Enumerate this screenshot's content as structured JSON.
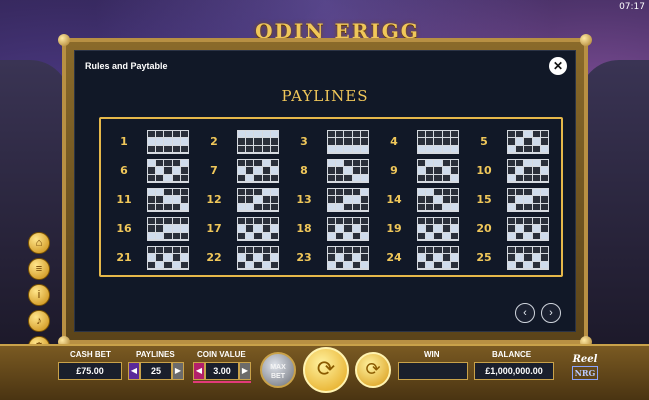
{
  "status": {
    "clock": "07:17"
  },
  "logo": {
    "text": "ODIN ERIGG"
  },
  "dialog": {
    "title": "Rules and Paytable",
    "close_symbol": "✕",
    "section_title": "PAYLINES"
  },
  "paylines": [
    {
      "number": "1",
      "pattern": [
        [
          0,
          0,
          0,
          0,
          0
        ],
        [
          1,
          1,
          1,
          1,
          1
        ],
        [
          0,
          0,
          0,
          0,
          0
        ]
      ]
    },
    {
      "number": "2",
      "pattern": [
        [
          1,
          1,
          1,
          1,
          1
        ],
        [
          0,
          0,
          0,
          0,
          0
        ],
        [
          0,
          0,
          0,
          0,
          0
        ]
      ]
    },
    {
      "number": "3",
      "pattern": [
        [
          0,
          0,
          0,
          0,
          0
        ],
        [
          0,
          0,
          0,
          0,
          0
        ],
        [
          1,
          1,
          1,
          1,
          1
        ]
      ]
    },
    {
      "number": "4",
      "pattern": [
        [
          0,
          0,
          0,
          0,
          0
        ],
        [
          0,
          0,
          0,
          0,
          0
        ],
        [
          1,
          1,
          1,
          1,
          1
        ]
      ]
    },
    {
      "number": "5",
      "pattern": [
        [
          0,
          0,
          1,
          0,
          0
        ],
        [
          0,
          1,
          0,
          1,
          0
        ],
        [
          1,
          0,
          0,
          0,
          1
        ]
      ]
    },
    {
      "number": "6",
      "pattern": [
        [
          1,
          0,
          0,
          0,
          1
        ],
        [
          0,
          1,
          0,
          1,
          0
        ],
        [
          0,
          0,
          1,
          0,
          0
        ]
      ]
    },
    {
      "number": "7",
      "pattern": [
        [
          0,
          0,
          0,
          1,
          0
        ],
        [
          1,
          0,
          1,
          0,
          1
        ],
        [
          0,
          1,
          0,
          0,
          0
        ]
      ]
    },
    {
      "number": "8",
      "pattern": [
        [
          1,
          1,
          0,
          0,
          0
        ],
        [
          0,
          0,
          1,
          0,
          0
        ],
        [
          0,
          0,
          0,
          1,
          1
        ]
      ]
    },
    {
      "number": "9",
      "pattern": [
        [
          0,
          1,
          1,
          0,
          0
        ],
        [
          1,
          0,
          0,
          1,
          0
        ],
        [
          0,
          0,
          0,
          0,
          1
        ]
      ]
    },
    {
      "number": "10",
      "pattern": [
        [
          0,
          0,
          1,
          1,
          0
        ],
        [
          0,
          1,
          0,
          0,
          1
        ],
        [
          1,
          0,
          0,
          0,
          0
        ]
      ]
    },
    {
      "number": "11",
      "pattern": [
        [
          1,
          1,
          0,
          0,
          0
        ],
        [
          0,
          0,
          1,
          1,
          0
        ],
        [
          0,
          0,
          0,
          0,
          1
        ]
      ]
    },
    {
      "number": "12",
      "pattern": [
        [
          0,
          0,
          0,
          1,
          1
        ],
        [
          0,
          0,
          1,
          0,
          0
        ],
        [
          1,
          1,
          0,
          0,
          0
        ]
      ]
    },
    {
      "number": "13",
      "pattern": [
        [
          0,
          0,
          0,
          0,
          1
        ],
        [
          0,
          0,
          1,
          1,
          0
        ],
        [
          1,
          1,
          0,
          0,
          0
        ]
      ]
    },
    {
      "number": "14",
      "pattern": [
        [
          1,
          1,
          0,
          0,
          0
        ],
        [
          0,
          0,
          1,
          0,
          0
        ],
        [
          0,
          0,
          0,
          1,
          1
        ]
      ]
    },
    {
      "number": "15",
      "pattern": [
        [
          0,
          0,
          0,
          1,
          1
        ],
        [
          0,
          1,
          1,
          0,
          0
        ],
        [
          1,
          0,
          0,
          0,
          0
        ]
      ]
    },
    {
      "number": "16",
      "pattern": [
        [
          0,
          0,
          0,
          0,
          0
        ],
        [
          0,
          0,
          1,
          1,
          1
        ],
        [
          1,
          1,
          0,
          0,
          0
        ]
      ]
    },
    {
      "number": "17",
      "pattern": [
        [
          0,
          0,
          0,
          0,
          0
        ],
        [
          1,
          0,
          1,
          0,
          1
        ],
        [
          0,
          1,
          0,
          1,
          0
        ]
      ]
    },
    {
      "number": "18",
      "pattern": [
        [
          0,
          0,
          0,
          0,
          0
        ],
        [
          0,
          1,
          0,
          1,
          0
        ],
        [
          1,
          0,
          1,
          0,
          1
        ]
      ]
    },
    {
      "number": "19",
      "pattern": [
        [
          0,
          0,
          0,
          0,
          0
        ],
        [
          1,
          0,
          1,
          0,
          1
        ],
        [
          0,
          1,
          0,
          1,
          0
        ]
      ]
    },
    {
      "number": "20",
      "pattern": [
        [
          0,
          0,
          0,
          0,
          0
        ],
        [
          0,
          1,
          0,
          1,
          0
        ],
        [
          1,
          0,
          1,
          0,
          1
        ]
      ]
    },
    {
      "number": "21",
      "pattern": [
        [
          0,
          0,
          0,
          0,
          0
        ],
        [
          1,
          0,
          1,
          0,
          1
        ],
        [
          0,
          1,
          0,
          1,
          0
        ]
      ]
    },
    {
      "number": "22",
      "pattern": [
        [
          0,
          0,
          0,
          0,
          0
        ],
        [
          1,
          0,
          1,
          0,
          1
        ],
        [
          0,
          1,
          0,
          1,
          0
        ]
      ]
    },
    {
      "number": "23",
      "pattern": [
        [
          0,
          0,
          0,
          0,
          0
        ],
        [
          0,
          1,
          0,
          1,
          0
        ],
        [
          1,
          0,
          1,
          0,
          1
        ]
      ]
    },
    {
      "number": "24",
      "pattern": [
        [
          0,
          0,
          0,
          0,
          0
        ],
        [
          1,
          0,
          1,
          0,
          1
        ],
        [
          0,
          1,
          0,
          1,
          0
        ]
      ]
    },
    {
      "number": "25",
      "pattern": [
        [
          0,
          0,
          0,
          0,
          0
        ],
        [
          0,
          1,
          0,
          1,
          0
        ],
        [
          1,
          0,
          1,
          0,
          1
        ]
      ]
    }
  ],
  "navigation": {
    "prev_symbol": "‹",
    "next_symbol": "›"
  },
  "side_menu": [
    {
      "icon": "home-icon",
      "glyph": "⌂"
    },
    {
      "icon": "menu-icon",
      "glyph": "≡"
    },
    {
      "icon": "info-icon",
      "glyph": "i"
    },
    {
      "icon": "sound-icon",
      "glyph": "♪"
    },
    {
      "icon": "settings-icon",
      "glyph": "⚙"
    },
    {
      "icon": "close-icon",
      "glyph": "✕"
    }
  ],
  "bottom_bar": {
    "cash_bet": {
      "label": "CASH BET",
      "value": "£75.00"
    },
    "paylines": {
      "label": "PAYLINES",
      "value": "25"
    },
    "coin_value": {
      "label": "COIN VALUE",
      "value": "3.00"
    },
    "max_bet": {
      "line1": "MAX",
      "line2": "BET"
    },
    "spin_symbol": "⟳",
    "autoplay_symbol": "⟳",
    "win": {
      "label": "WIN",
      "value": ""
    },
    "balance": {
      "label": "BALANCE",
      "value": "£1,000,000.00"
    },
    "brand": {
      "line1": "Reel",
      "line2": "NRG"
    }
  },
  "colors": {
    "accent_gold": "#f0c75a",
    "panel_bg": "#111827",
    "pattern_on": "#d0dcec",
    "pattern_off": "#2a2f3a"
  }
}
